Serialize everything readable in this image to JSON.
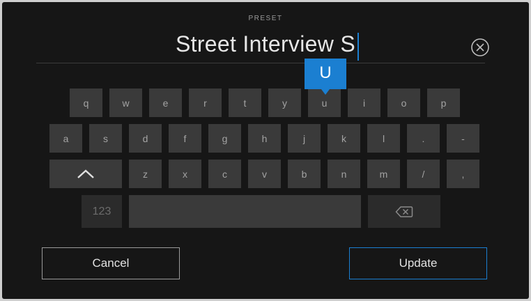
{
  "header": {
    "title": "PRESET"
  },
  "input": {
    "value": "Street Interview S"
  },
  "popup": {
    "letter": "U"
  },
  "keyboard": {
    "row1": [
      "q",
      "w",
      "e",
      "r",
      "t",
      "y",
      "u",
      "i",
      "o",
      "p"
    ],
    "row2": [
      "a",
      "s",
      "d",
      "f",
      "g",
      "h",
      "j",
      "k",
      "l",
      ".",
      "-"
    ],
    "row3": [
      "z",
      "x",
      "c",
      "v",
      "b",
      "n",
      "m",
      "/",
      ","
    ],
    "numbers_label": "123"
  },
  "actions": {
    "cancel_label": "Cancel",
    "update_label": "Update"
  },
  "colors": {
    "accent": "#1b7fd1",
    "background": "#161616",
    "key": "#3a3a3a"
  },
  "icons": {
    "clear": "circle-x-icon",
    "shift": "chevron-up-icon",
    "backspace": "backspace-icon"
  }
}
